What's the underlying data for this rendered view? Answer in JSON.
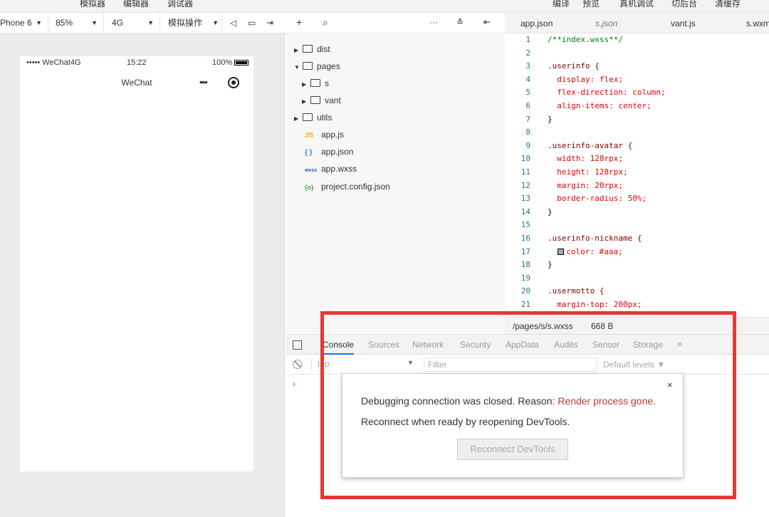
{
  "menu": {
    "left": [
      "模拟器",
      "编辑器",
      "调试器"
    ],
    "right": [
      "编译",
      "预览",
      "真机调试",
      "切后台",
      "清缓存"
    ]
  },
  "simulator": {
    "device": "Phone 6",
    "zoom": "85%",
    "network": "4G",
    "operation": "模拟操作",
    "status": {
      "carrier": "••••• WeChat4G",
      "time": "15:22",
      "battery": "100%"
    },
    "nav_title": "WeChat",
    "nav_dots": "•••"
  },
  "tree_toolbar": {
    "add": "+",
    "more": "···"
  },
  "tree": [
    {
      "label": "dist",
      "kind": "folder",
      "state": "collapsed"
    },
    {
      "label": "pages",
      "kind": "folder",
      "state": "expanded"
    },
    {
      "label": "s",
      "kind": "folder",
      "state": "collapsed"
    },
    {
      "label": "vant",
      "kind": "folder",
      "state": "collapsed"
    },
    {
      "label": "utils",
      "kind": "folder",
      "state": "collapsed"
    },
    {
      "label": "app.js",
      "kind": "file",
      "badge": "JS"
    },
    {
      "label": "app.json",
      "kind": "file",
      "badge": "{ }"
    },
    {
      "label": "app.wxss",
      "kind": "file",
      "badge": "wxss"
    },
    {
      "label": "project.config.json",
      "kind": "file",
      "badge": "{o}"
    }
  ],
  "editor_tabs": [
    "app.json",
    "s.json",
    "vant.js",
    "s.wxm"
  ],
  "code": [
    {
      "n": "1",
      "t": "/**index.wxss**/"
    },
    {
      "n": "2",
      "t": ""
    },
    {
      "n": "3",
      "t": ".userinfo {"
    },
    {
      "n": "4",
      "t": "  display: flex;"
    },
    {
      "n": "5",
      "t": "  flex-direction: column;"
    },
    {
      "n": "6",
      "t": "  align-items: center;"
    },
    {
      "n": "7",
      "t": "}"
    },
    {
      "n": "8",
      "t": ""
    },
    {
      "n": "9",
      "t": ".userinfo-avatar {"
    },
    {
      "n": "10",
      "t": "  width: 128rpx;"
    },
    {
      "n": "11",
      "t": "  height: 128rpx;"
    },
    {
      "n": "12",
      "t": "  margin: 20rpx;"
    },
    {
      "n": "13",
      "t": "  border-radius: 50%;"
    },
    {
      "n": "14",
      "t": "}"
    },
    {
      "n": "15",
      "t": ""
    },
    {
      "n": "16",
      "t": ".userinfo-nickname {"
    },
    {
      "n": "17",
      "t": "  color: #aaa;"
    },
    {
      "n": "18",
      "t": "}"
    },
    {
      "n": "19",
      "t": ""
    },
    {
      "n": "20",
      "t": ".usermotto {"
    },
    {
      "n": "21",
      "t": "  margin-top: 200px;"
    }
  ],
  "editor_status": {
    "path": "/pages/s/s.wxss",
    "size": "668 B"
  },
  "devtools": {
    "tabs": [
      "Console",
      "Sources",
      "Network",
      "Security",
      "AppData",
      "Audits",
      "Sensor",
      "Storage",
      "»"
    ],
    "context": "top",
    "filter_placeholder": "Filter",
    "levels": "Default levels ▼",
    "prompt": "›"
  },
  "dialog": {
    "msg_prefix": "Debugging connection was closed. Reason: ",
    "reason": "Render process gone.",
    "msg2": "Reconnect when ready by reopening DevTools.",
    "button": "Reconnect DevTools",
    "close": "×"
  },
  "colors": {
    "annotation": "#e53935",
    "reason": "#c0392b",
    "active_tab": "#1a73e8"
  }
}
